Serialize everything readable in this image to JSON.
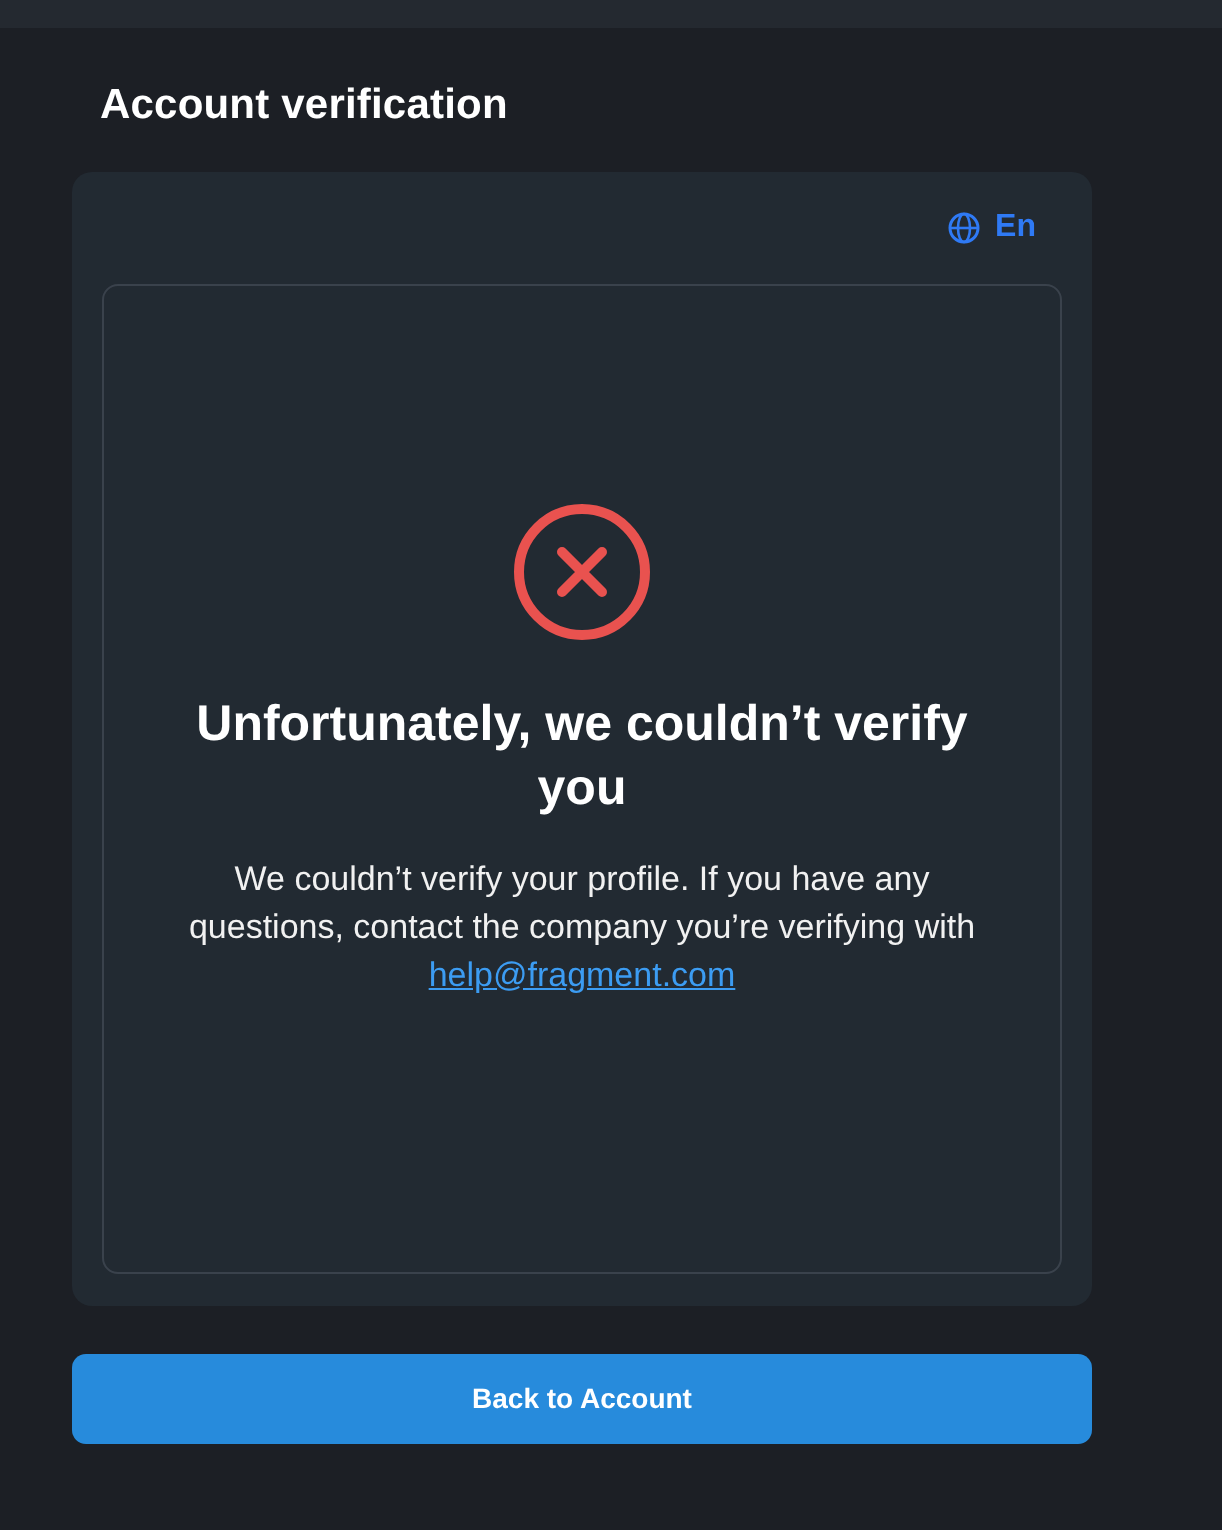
{
  "page": {
    "title": "Account verification"
  },
  "language": {
    "label": "En"
  },
  "result": {
    "kind": "error",
    "heading": "Unfortunately, we couldn’t verify you",
    "message": "We couldn’t verify your profile. If you have any questions, contact the company you’re verifying with",
    "email": "help@fragment.com"
  },
  "actions": [
    {
      "label": "Back to Account",
      "kind": "primary"
    }
  ]
}
